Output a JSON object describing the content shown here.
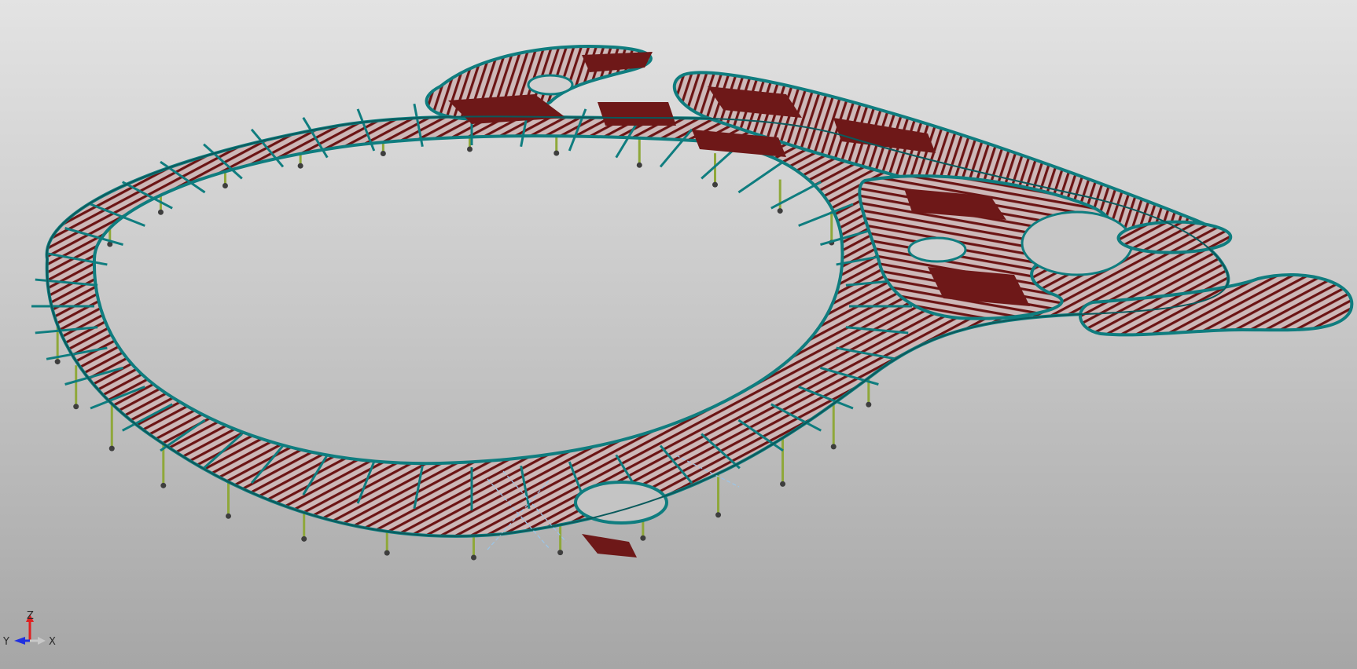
{
  "viewport": {
    "background_top": "#e3e3e3",
    "background_bottom": "#a6a6a6"
  },
  "model": {
    "description": "",
    "colors": {
      "frame": "#0f7d7f",
      "frame_dark": "#0a5a5c",
      "joist": "#6b1414",
      "deck_panel": "#6e1818",
      "column": "#8fa83a",
      "footing": "#3e3e3e",
      "bracing": "#9ac6ea"
    }
  },
  "triad": {
    "z_label": "Z",
    "y_label": "Y",
    "x_label": "X",
    "z_color": "#e02020",
    "x_color": "#c8c8c8",
    "y_color": "#2030e0"
  }
}
